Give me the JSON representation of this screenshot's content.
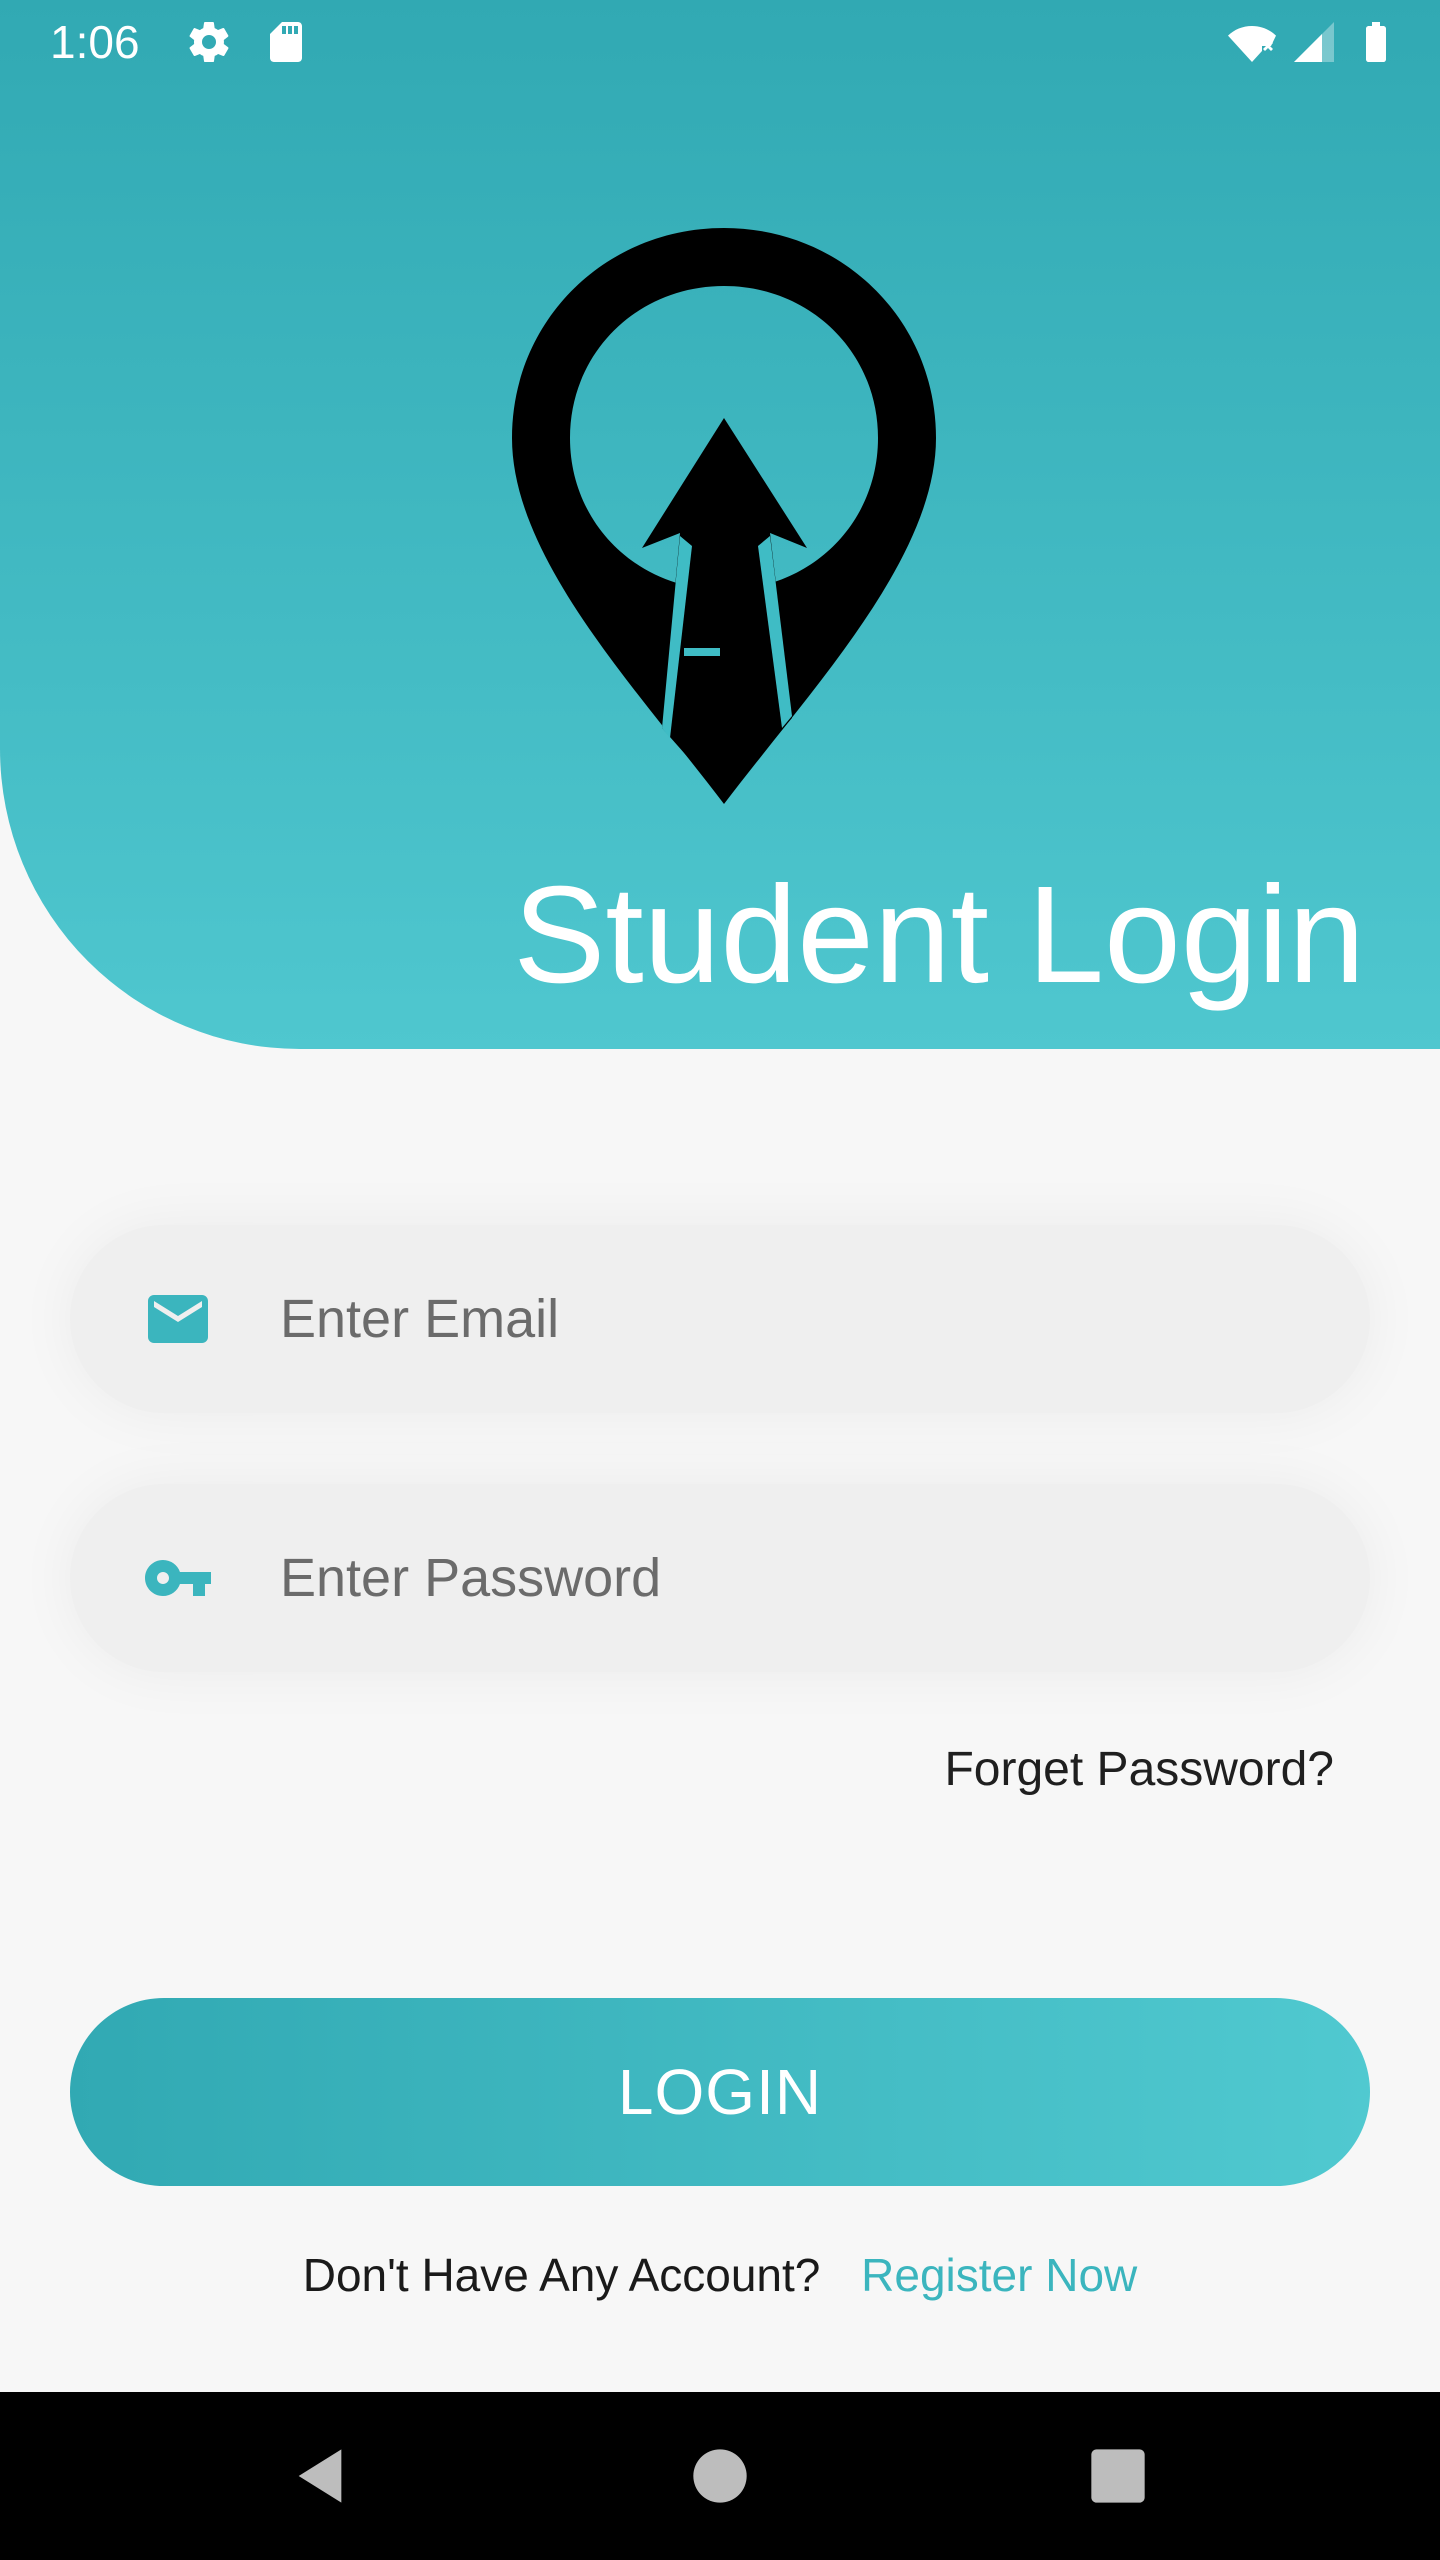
{
  "status_bar": {
    "time": "1:06",
    "icons": [
      "gear-icon",
      "sd-card-icon",
      "wifi-off-icon",
      "signal-icon",
      "battery-icon"
    ]
  },
  "header": {
    "title": "Student Login",
    "logo": "location-pin-arrow-logo"
  },
  "form": {
    "email_placeholder": "Enter Email",
    "email_icon": "envelope-icon",
    "password_placeholder": "Enter Password",
    "password_icon": "key-icon",
    "forget_label": "Forget Password?",
    "login_label": "LOGIN"
  },
  "register": {
    "question": "Don't Have Any Account?",
    "link": "Register Now"
  },
  "nav": {
    "buttons": [
      "back-icon",
      "home-icon",
      "recents-icon"
    ]
  },
  "colors": {
    "accent": "#3bb5be",
    "gradient_start": "#31a9b3",
    "gradient_end": "#50c9d0",
    "field_bg": "#efefef",
    "background": "#f7f7f7"
  }
}
